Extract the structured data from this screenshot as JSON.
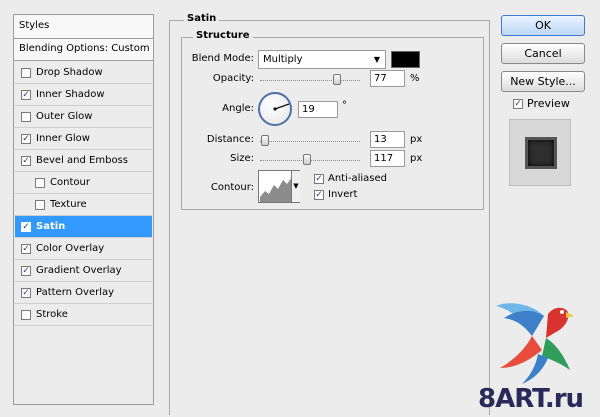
{
  "styles_panel": {
    "header": "Styles",
    "blending_options": "Blending Options: Custom",
    "items": [
      {
        "label": "Drop Shadow",
        "checked": false,
        "mark": ""
      },
      {
        "label": "Inner Shadow",
        "checked": true,
        "mark": "✓"
      },
      {
        "label": "Outer Glow",
        "checked": false,
        "mark": ""
      },
      {
        "label": "Inner Glow",
        "checked": true,
        "mark": "✓"
      },
      {
        "label": "Bevel and Emboss",
        "checked": true,
        "mark": "✓"
      },
      {
        "label": "Contour",
        "checked": false,
        "mark": ""
      },
      {
        "label": "Texture",
        "checked": false,
        "mark": ""
      },
      {
        "label": "Satin",
        "checked": true,
        "mark": "✓",
        "selected": true
      },
      {
        "label": "Color Overlay",
        "checked": true,
        "mark": "✓"
      },
      {
        "label": "Gradient Overlay",
        "checked": true,
        "mark": "✓"
      },
      {
        "label": "Pattern Overlay",
        "checked": true,
        "mark": "✓"
      },
      {
        "label": "Stroke",
        "checked": false,
        "mark": ""
      }
    ]
  },
  "satin": {
    "title": "Satin",
    "structure_title": "Structure",
    "blend_mode": {
      "label": "Blend Mode:",
      "value": "Multiply",
      "color": "#000000"
    },
    "opacity": {
      "label": "Opacity:",
      "value": "77",
      "unit": "%",
      "level": 0.77
    },
    "angle": {
      "label": "Angle:",
      "value": "19",
      "unit": "°"
    },
    "distance": {
      "label": "Distance:",
      "value": "13",
      "unit": "px",
      "level": 0.05
    },
    "size": {
      "label": "Size:",
      "value": "117",
      "unit": "px",
      "level": 0.47
    },
    "contour": {
      "label": "Contour:"
    },
    "anti_aliased": {
      "label": "Anti-aliased",
      "checked": true,
      "mark": "✓"
    },
    "invert": {
      "label": "Invert",
      "checked": true,
      "mark": "✓"
    }
  },
  "buttons": {
    "ok": "OK",
    "cancel": "Cancel",
    "new_style": "New Style...",
    "preview_label": "Preview",
    "preview_mark": "✓"
  },
  "watermark": {
    "text": "8ART.ru"
  },
  "colors": {
    "selection": "#3399ff",
    "accent_border": "#3d7bd1"
  }
}
